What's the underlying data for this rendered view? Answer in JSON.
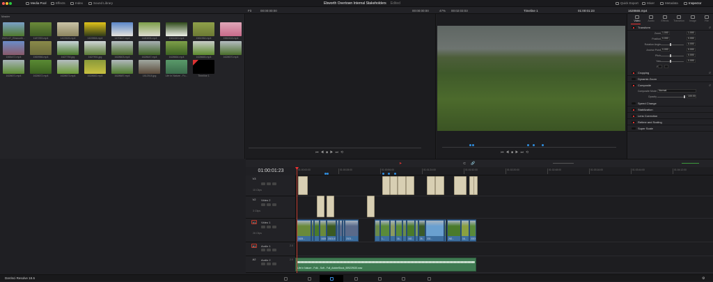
{
  "titlebar": {
    "tabs": [
      "Media Pool",
      "Effects",
      "Index",
      "Sound Library"
    ],
    "project_title": "Ebworth Overtown Internal Stakeholders",
    "project_status": "Edited",
    "right_tabs": [
      "Quick Export",
      "Mixer",
      "Metadata",
      "Inspector"
    ]
  },
  "toolrow": {
    "source_fps": "Fit",
    "source_tc": "00:00:00:00",
    "src_duration": "00:00:00:00",
    "zoom": "47%",
    "tl_duration": "00:02:03:03",
    "timeline_name": "Timeline 1",
    "timeline_tc": "01:00:01:23",
    "clip_name": "1628665.mp4"
  },
  "pool": {
    "bin": "Master",
    "items": [
      {
        "name": "2023-07_Ebsworth...",
        "c1": "#7aa0c8",
        "c2": "#4f7a2c"
      },
      {
        "name": "1187253.mp4",
        "c1": "#6b8a3a",
        "c2": "#3c5a24"
      },
      {
        "name": "1422626.mp4",
        "c1": "#c9c3a6",
        "c2": "#8d8660"
      },
      {
        "name": "1422654.mp4",
        "c1": "#e2c41a",
        "c2": "#2f3a18"
      },
      {
        "name": "1470617.mp4",
        "c1": "#5a86c8",
        "c2": "#e8e4dc"
      },
      {
        "name": "1480895.mp4",
        "c1": "#7da04a",
        "c2": "#dedcd0"
      },
      {
        "name": "1561849.mp4",
        "c1": "#2f4a1a",
        "c2": "#eef0e8"
      },
      {
        "name": "1561964.mp4",
        "c1": "#8fa04a",
        "c2": "#6c7a34"
      },
      {
        "name": "1562416.mp4",
        "c1": "#e0a6b8",
        "c2": "#c86a8a"
      },
      {
        "name": "1565472.mp4",
        "c1": "#6a8cc8",
        "c2": "#8a5a6a"
      },
      {
        "name": "1569966.mp4",
        "c1": "#8a8a4a",
        "c2": "#6a6a3a"
      },
      {
        "name": "1627750.jpg",
        "c1": "#c8d4d8",
        "c2": "#4a7a2a"
      },
      {
        "name": "1627901.jpg",
        "c1": "#d0d6d8",
        "c2": "#5a7a34"
      },
      {
        "name": "1628603.mp4",
        "c1": "#b8c0c4",
        "c2": "#4a6a2a"
      },
      {
        "name": "1628647.mp4",
        "c1": "#a8b0b4",
        "c2": "#3e6224"
      },
      {
        "name": "1628664.mp4",
        "c1": "#7ea04a",
        "c2": "#3c6222"
      },
      {
        "name": "1628665.mp4",
        "c1": "#c8ccc8",
        "c2": "#5c8a2c"
      },
      {
        "name": "1628670.mp4",
        "c1": "#b4bcc0",
        "c2": "#4a6e2a"
      },
      {
        "name": "1628671.mp4",
        "c1": "#a8b4b8",
        "c2": "#5a8a30"
      },
      {
        "name": "1628672.mp4",
        "c1": "#5a8a34",
        "c2": "#3a6020"
      },
      {
        "name": "1628673.mp4",
        "c1": "#b4bcc0",
        "c2": "#6a9a34"
      },
      {
        "name": "1628682.mp4",
        "c1": "#8a9a3a",
        "c2": "#c8c040"
      },
      {
        "name": "1628687.mp4",
        "c1": "#b0b8bc",
        "c2": "#4e7a2c"
      },
      {
        "name": "1812518.jpg",
        "c1": "#a0a8a0",
        "c2": "#5a4a3a"
      },
      {
        "name": "Life in Nature - Fo...",
        "c1": "#5a9a6a",
        "c2": "#3a6a4a"
      },
      {
        "name": "Timeline 1",
        "c1": "#000000",
        "c2": "#000000"
      }
    ]
  },
  "inspector": {
    "tabs": [
      "Video",
      "Audio",
      "Effects",
      "Transition",
      "Image",
      "File"
    ],
    "sections": {
      "transform": "Transform",
      "cropping": "Cropping",
      "dynamic_zoom": "Dynamic Zoom",
      "composite": "Composite",
      "speed": "Speed Change",
      "stab": "Stabilization",
      "lens": "Lens Correction",
      "retime": "Retime and Scaling",
      "superscale": "Super Scale"
    },
    "zoom_label": "Zoom",
    "zoom_x": "1.000",
    "zoom_y": "1.000",
    "position_label": "Position",
    "pos_x": "0.000",
    "pos_y": "0.000",
    "rotation_label": "Rotation Angle",
    "rotation": "0.000",
    "anchor_label": "Anchor Point",
    "anchor_x": "0.000",
    "anchor_y": "0.000",
    "pitch_label": "Pitch",
    "pitch": "0.000",
    "yaw_label": "Yaw",
    "yaw": "0.000",
    "flip_label": "Flip",
    "composite_mode_label": "Composite Mode",
    "composite_mode": "Normal",
    "opacity_label": "Opacity",
    "opacity": "100.00",
    "x": "X",
    "y": "Y"
  },
  "timeline": {
    "timecode": "01:00:01:23",
    "ruler": [
      "01:00:00:00",
      "01:00:28:00",
      "01:00:56:00",
      "01:01:24:00",
      "01:01:52:00",
      "01:02:20:00",
      "01:02:48:00",
      "01:03:16:00",
      "01:03:44:00",
      "01:04:12:00"
    ],
    "tracks": [
      {
        "id": "V3",
        "name": "",
        "count": "10 Clips"
      },
      {
        "id": "V2",
        "name": "Video 2",
        "count": "3 Clips"
      },
      {
        "id": "V1",
        "name": "Video 1",
        "count": "26 Clips"
      },
      {
        "id": "A1",
        "name": "Audio 1",
        "channels": "2.0"
      },
      {
        "id": "A2",
        "name": "Audio 2",
        "channels": "2.0"
      }
    ],
    "v1_labels": [
      "1628...",
      "1628...",
      "2023-07...",
      "2023...",
      "1...",
      "16...",
      "162...",
      "26...",
      "202...",
      "262...",
      "16...",
      "2023..."
    ],
    "audio_clip": "Life In Nature - Folk - Soft - Full_AdobeStock_559229020.wav"
  },
  "app": {
    "name": "DaVinci Resolve 18.6"
  }
}
